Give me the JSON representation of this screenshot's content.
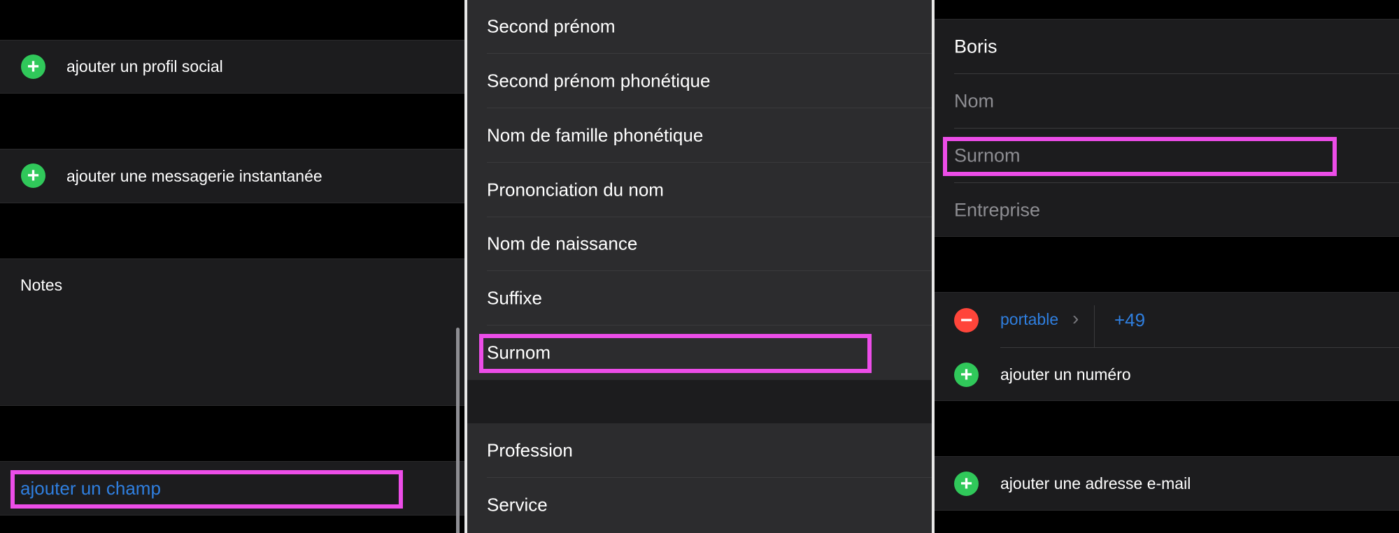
{
  "left": {
    "add_social_profile": "ajouter un profil social",
    "add_instant_message": "ajouter une messagerie instantanée",
    "notes_label": "Notes",
    "add_field": "ajouter un champ"
  },
  "middle": {
    "items": [
      "Second prénom",
      "Second prénom phonétique",
      "Nom de famille phonétique",
      "Prononciation du nom",
      "Nom de naissance",
      "Suffixe",
      "Surnom"
    ],
    "items2": [
      "Profession",
      "Service"
    ]
  },
  "right": {
    "first_name": "Boris",
    "last_name_placeholder": "Nom",
    "nickname_placeholder": "Surnom",
    "company_placeholder": "Entreprise",
    "phone_label": "portable",
    "phone_value": "+49",
    "add_number": "ajouter un numéro",
    "add_email": "ajouter une adresse e-mail"
  },
  "colors": {
    "accent": "#2f7fe0",
    "highlight": "#ec4de8",
    "add": "#30c85a",
    "remove": "#ff453a"
  }
}
